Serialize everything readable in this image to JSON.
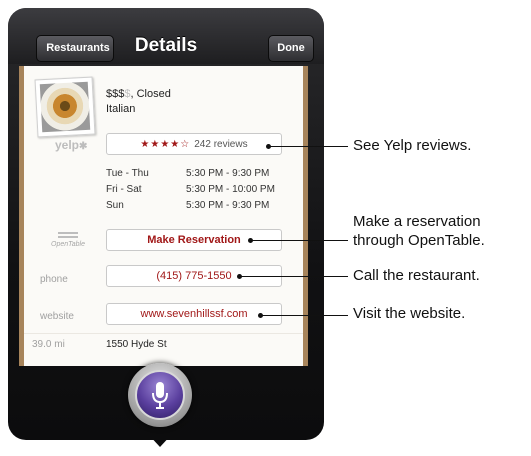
{
  "navbar": {
    "title": "Details",
    "back_label": "Restaurants",
    "done_label": "Done"
  },
  "restaurant": {
    "price": "$$$",
    "price_muted": "$",
    "status": ", Closed",
    "cuisine": "Italian"
  },
  "yelp": {
    "logo": "yelp",
    "stars": "★★★★☆",
    "rating": 4.5,
    "reviews": "242 reviews"
  },
  "hours": [
    {
      "day": "Tue - Thu",
      "time": "5:30 PM -  9:30 PM"
    },
    {
      "day": "Fri - Sat",
      "time": "5:30 PM - 10:00 PM"
    },
    {
      "day": "Sun",
      "time": "5:30 PM -  9:30 PM"
    }
  ],
  "opentable": {
    "logo_text": "OpenTable",
    "button_label": "Make Reservation"
  },
  "phone": {
    "label": "phone",
    "value": "(415) 775-1550"
  },
  "website": {
    "label": "website",
    "value": "www.sevenhillssf.com"
  },
  "address": {
    "distance": "39.0 mi",
    "street": "1550 Hyde St"
  },
  "siri": {
    "icon": "microphone-icon"
  },
  "callouts": [
    {
      "lines": [
        "See Yelp reviews."
      ]
    },
    {
      "lines": [
        "Make a reservation",
        "through OpenTable."
      ]
    },
    {
      "lines": [
        "Call the restaurant."
      ]
    },
    {
      "lines": [
        "Visit the website."
      ]
    }
  ],
  "colors": {
    "accent_red": "#a11818",
    "siri_purple": "#5a3f9e",
    "card_wood": "#b8946a"
  }
}
